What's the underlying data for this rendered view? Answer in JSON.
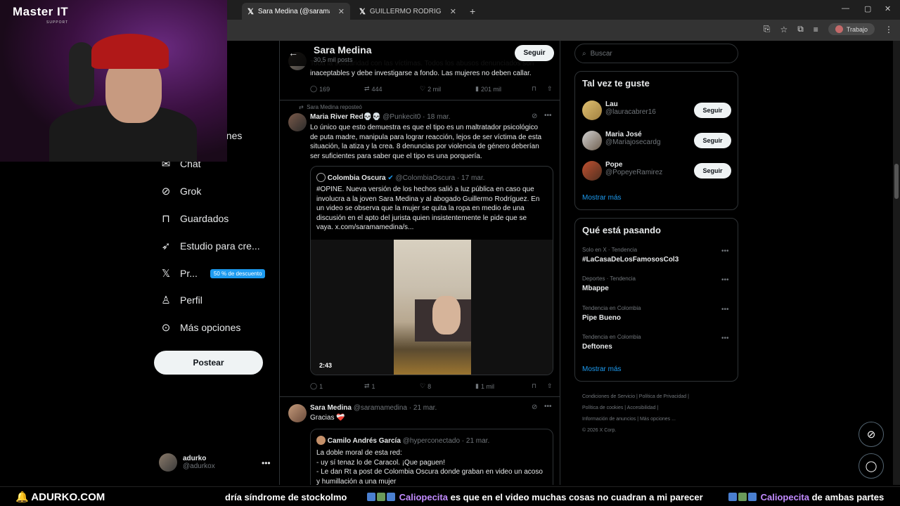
{
  "browser": {
    "tabs": [
      {
        "label": "Sara Medina (@saramamedina)"
      },
      {
        "label": "GUILLERMO RODRIGUEZ M (@"
      }
    ],
    "profile_label": "Trabajo"
  },
  "stream": {
    "logo": "Master IT",
    "logo_sub": "SUPPORT"
  },
  "nav": {
    "items": [
      {
        "label": "…ones",
        "icon": "more-circle-icon"
      },
      {
        "label": "Chat",
        "icon": "mail-icon"
      },
      {
        "label": "Grok",
        "icon": "grok-icon"
      },
      {
        "label": "Guardados",
        "icon": "bookmark-icon"
      },
      {
        "label": "Estudio para cre...",
        "icon": "rocket-icon"
      },
      {
        "label": "Pr...",
        "icon": "x-logo-icon"
      },
      {
        "label": "Perfil",
        "icon": "person-icon"
      },
      {
        "label": "Más opciones",
        "icon": "more-circle-icon"
      }
    ],
    "premium_badge": "50 % de descuento",
    "post_button": "Postear",
    "account_name": "adurko",
    "account_handle": "@adurkox"
  },
  "profile_header": {
    "name": "Sara Medina",
    "posts_count": "30,5 mil posts",
    "follow_label": "Seguir"
  },
  "feed": {
    "partial_post": {
      "text_line1": "Toda la solidaridad con las víctimas. Todos los abusos denunciados son",
      "text_line2": "inaceptables y debe investigarse a fondo. Las mujeres no deben callar.",
      "replies": "169",
      "reposts": "444",
      "likes": "2 mil",
      "views": "201 mil"
    },
    "repost_post": {
      "repost_label": "Sara Medina reposteó",
      "author": "Maria River Red💀💀",
      "handle_date": "@Punkecit0 · 18 mar.",
      "text": [
        "Lo único que esto demuestra es que el tipo es un maltratador psicológico",
        "de puta madre, manipula para lograr reacción, lejos de ser víctima de esta",
        "situación, la atiza y la crea. 8 denuncias por violencia de género deberían",
        "ser suficientes para saber que el tipo es una porquería."
      ],
      "quote": {
        "author": "Colombia Oscura",
        "handle_date": "@ColombiaOscura · 17 mar.",
        "text": [
          "#OPINE. Nueva versión de los hechos salió a luz pública en caso que",
          "involucra a la joven Sara Medina y al abogado Guillermo Rodríguez. En",
          "un video se observa que la mujer se quita la ropa en medio de una",
          "discusión en el apto del jurista quien insistentemente le pide que se",
          "vaya.  x.com/saramamedina/s..."
        ],
        "video_duration": "2:43"
      },
      "replies": "1",
      "reposts": "1",
      "likes": "8",
      "views": "1 mil"
    },
    "third_post": {
      "author": "Sara Medina",
      "handle_date": "@saramamedina · 21 mar.",
      "text": "Gracias ❤️‍🩹",
      "quote": {
        "author": "Camilo Andrés García",
        "handle_date": "@hyperconectado · 21 mar.",
        "text": [
          "La doble moral de esta red:",
          "- uy sí tenaz lo de Caracol. ¡Que paguen!",
          "- Le dan Rt a post de Colombia Oscura donde graban en video un acoso",
          "y humillación a una mujer"
        ]
      }
    }
  },
  "sidebar": {
    "search_placeholder": "Buscar",
    "who_to_follow_title": "Tal vez te guste",
    "suggestions": [
      {
        "name": "Lau",
        "handle": "@lauracabrer16",
        "button": "Seguir"
      },
      {
        "name": "Maria José",
        "handle": "@Mariajosecardg",
        "button": "Seguir"
      },
      {
        "name": "Pope",
        "handle": "@PopeyeRamirez",
        "button": "Seguir"
      }
    ],
    "show_more": "Mostrar más",
    "trends_title": "Qué está pasando",
    "trends": [
      {
        "meta": "Solo en X · Tendencia",
        "name": "#LaCasaDeLosFamososCol3"
      },
      {
        "meta": "Deportes · Tendencia",
        "name": "Mbappe"
      },
      {
        "meta": "Tendencia en Colombia",
        "name": "Pipe Bueno"
      },
      {
        "meta": "Tendencia en Colombia",
        "name": "Deftones"
      }
    ],
    "trends_more": "Mostrar más",
    "footer": {
      "line1": "Condiciones de Servicio  |  Política de Privacidad  |",
      "line2": "Política de cookies  |  Accesibilidad  |",
      "line3": "Información de anuncios  |  Más opciones ...",
      "line4": "© 2026 X Corp."
    }
  },
  "ticker": {
    "logo": "🔔 ADURKO.COM",
    "msg1": "dría síndrome de stockolmo",
    "user2": "Caliopecita",
    "msg2": "es que en el video muchas cosas no cuadran a mi parecer",
    "user3": "Caliopecita",
    "msg3": "de ambas partes"
  }
}
